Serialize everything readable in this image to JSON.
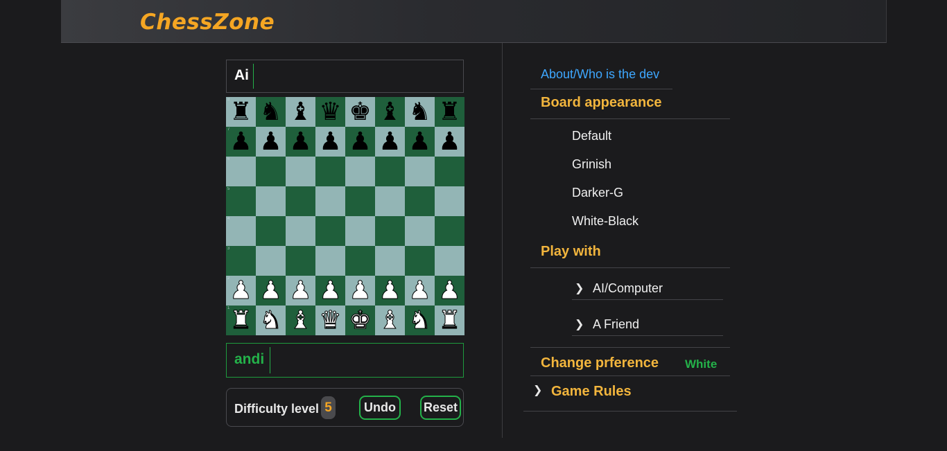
{
  "header": {
    "logo": "ChessZone"
  },
  "players": {
    "top": "Ai",
    "bottom": "andi"
  },
  "board": {
    "ranks": [
      "8",
      "7",
      "6",
      "5",
      "4",
      "3",
      "2",
      "1"
    ],
    "rows": [
      [
        {
          "g": "♜",
          "c": "b"
        },
        {
          "g": "♞",
          "c": "b"
        },
        {
          "g": "♝",
          "c": "b"
        },
        {
          "g": "♛",
          "c": "b"
        },
        {
          "g": "♚",
          "c": "b"
        },
        {
          "g": "♝",
          "c": "b"
        },
        {
          "g": "♞",
          "c": "b"
        },
        {
          "g": "♜",
          "c": "b"
        }
      ],
      [
        {
          "g": "♟",
          "c": "b"
        },
        {
          "g": "♟",
          "c": "b"
        },
        {
          "g": "♟",
          "c": "b"
        },
        {
          "g": "♟",
          "c": "b"
        },
        {
          "g": "♟",
          "c": "b"
        },
        {
          "g": "♟",
          "c": "b"
        },
        {
          "g": "♟",
          "c": "b"
        },
        {
          "g": "♟",
          "c": "b"
        }
      ],
      [
        null,
        null,
        null,
        null,
        null,
        null,
        null,
        null
      ],
      [
        null,
        null,
        null,
        null,
        null,
        null,
        null,
        null
      ],
      [
        null,
        null,
        null,
        null,
        null,
        null,
        null,
        null
      ],
      [
        null,
        null,
        null,
        null,
        null,
        null,
        null,
        null
      ],
      [
        {
          "g": "♟",
          "c": "w"
        },
        {
          "g": "♟",
          "c": "w"
        },
        {
          "g": "♟",
          "c": "w"
        },
        {
          "g": "♟",
          "c": "w"
        },
        {
          "g": "♟",
          "c": "w"
        },
        {
          "g": "♟",
          "c": "w"
        },
        {
          "g": "♟",
          "c": "w"
        },
        {
          "g": "♟",
          "c": "w"
        }
      ],
      [
        {
          "g": "♜",
          "c": "w"
        },
        {
          "g": "♞",
          "c": "w"
        },
        {
          "g": "♝",
          "c": "w"
        },
        {
          "g": "♛",
          "c": "w"
        },
        {
          "g": "♚",
          "c": "w"
        },
        {
          "g": "♝",
          "c": "w"
        },
        {
          "g": "♞",
          "c": "w"
        },
        {
          "g": "♜",
          "c": "w"
        }
      ]
    ],
    "colors": {
      "light": "#93b5b5",
      "dark": "#1f5f3b"
    }
  },
  "controls": {
    "difficulty_label": "Difficulty level",
    "difficulty_value": "5",
    "undo": "Undo",
    "reset": "Reset"
  },
  "sidebar": {
    "about": "About/Who is the dev",
    "board_appearance": "Board appearance",
    "appearance_options": [
      "Default",
      "Grinish",
      "Darker-G",
      "White-Black"
    ],
    "play_with": "Play with",
    "play_options": [
      "AI/Computer",
      "A Friend"
    ],
    "change_preference": "Change prference",
    "preference_value": "White",
    "game_rules": "Game Rules"
  },
  "colors": {
    "accent": "#f5a623",
    "green": "#24b24a",
    "link": "#3ea7ff",
    "background": "#1b1b1d"
  }
}
